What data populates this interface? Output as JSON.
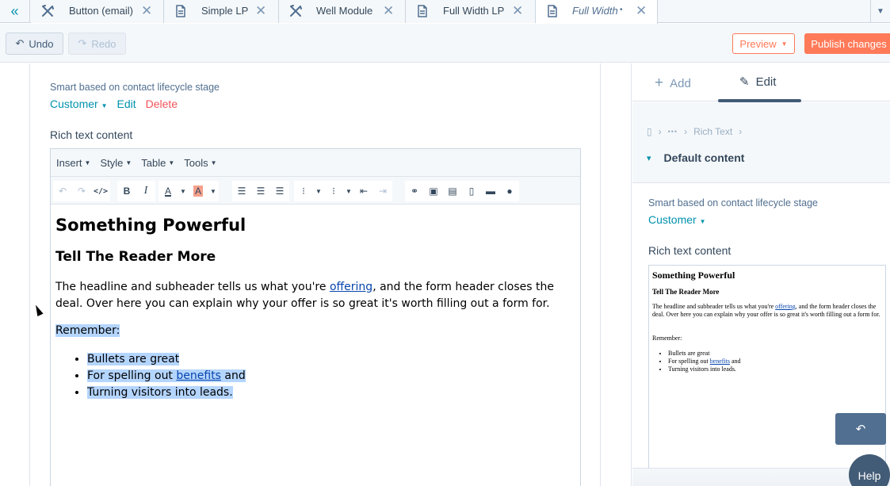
{
  "tabs": [
    {
      "label": "Button (email)",
      "icon": "wrench-icon",
      "active": false
    },
    {
      "label": "Simple LP",
      "icon": "page-icon",
      "active": false
    },
    {
      "label": "Well Module",
      "icon": "wrench-icon",
      "active": false
    },
    {
      "label": "Full Width LP",
      "icon": "page-icon",
      "active": false
    },
    {
      "label": "Full Width",
      "icon": "page-icon",
      "active": true,
      "unsaved_dot": "•"
    }
  ],
  "tab_close_glyph": "✕",
  "toolbar": {
    "undo_label": "Undo",
    "redo_label": "Redo",
    "preview_label": "Preview",
    "publish_label": "Publish changes"
  },
  "editor": {
    "smart_label": "Smart based on contact lifecycle stage",
    "smart_value": "Customer",
    "edit_link": "Edit",
    "delete_link": "Delete",
    "rich_text_label": "Rich text content",
    "menu": [
      "Insert",
      "Style",
      "Table",
      "Tools"
    ],
    "content": {
      "h1": "Something Powerful",
      "h2": "Tell The Reader More",
      "body_before": "The headline and subheader tells us what you're ",
      "body_link": "offering",
      "body_after": ", and the form header closes the deal. Over here you can explain why your offer is so great it's worth filling out a form for.",
      "remember": "Remember: ",
      "bullet1": "Bullets are great ",
      "bullet2_before": "For spelling out ",
      "bullet2_link": "benefits",
      "bullet2_after": " and",
      "bullet3": "Turning visitors into leads."
    }
  },
  "sidebar": {
    "tab_add": "Add",
    "tab_edit": "Edit",
    "breadcrumb_ellipsis": "•••",
    "breadcrumb_current": "Rich Text",
    "default_content": "Default content",
    "smart_label": "Smart based on contact lifecycle stage",
    "smart_value": "Customer",
    "rich_text_label": "Rich text content",
    "help_label": "Help"
  },
  "colors": {
    "accent": "#0091ae",
    "primary_orange": "#ff7a59",
    "danger": "#f2545b",
    "text": "#33475b",
    "selection": "#b4d5fe"
  }
}
